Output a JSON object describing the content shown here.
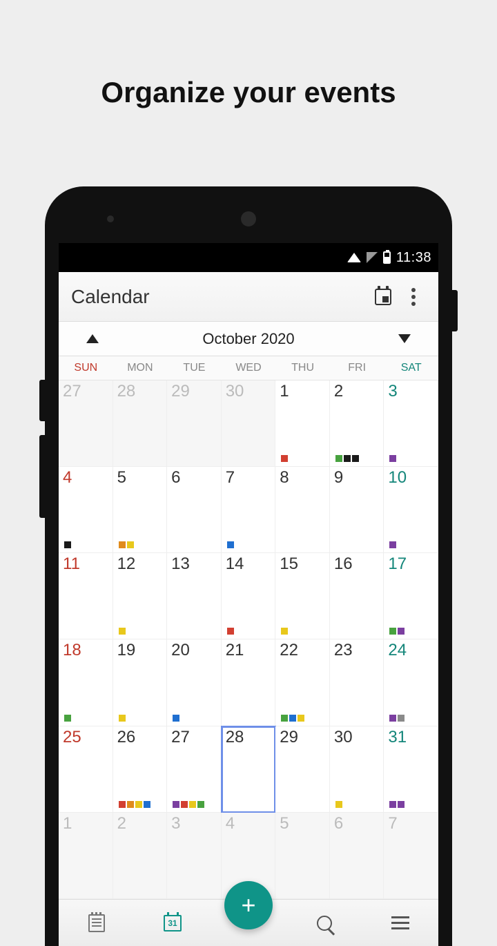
{
  "headline": "Organize your events",
  "status": {
    "time": "11:38"
  },
  "appbar": {
    "title": "Calendar"
  },
  "monthbar": {
    "label": "October 2020"
  },
  "weekdays": [
    "SUN",
    "MON",
    "TUE",
    "WED",
    "THU",
    "FRI",
    "SAT"
  ],
  "colors": {
    "red": "#d23f31",
    "green": "#48a23f",
    "black": "#1a1a1a",
    "purple": "#7b3fa0",
    "orange": "#e08b1c",
    "yellow": "#e8c81c",
    "blue": "#1f6fd0",
    "gray": "#8a8a8a",
    "teal": "#0f9488"
  },
  "grid": [
    [
      {
        "n": "27",
        "dim": true,
        "dow": "sun",
        "ev": []
      },
      {
        "n": "28",
        "dim": true,
        "ev": []
      },
      {
        "n": "29",
        "dim": true,
        "ev": []
      },
      {
        "n": "30",
        "dim": true,
        "ev": []
      },
      {
        "n": "1",
        "ev": [
          "red"
        ]
      },
      {
        "n": "2",
        "ev": [
          "green",
          "black",
          "black"
        ]
      },
      {
        "n": "3",
        "dow": "sat",
        "ev": [
          "purple"
        ]
      }
    ],
    [
      {
        "n": "4",
        "dow": "sun",
        "ev": [
          "black"
        ]
      },
      {
        "n": "5",
        "ev": [
          "orange",
          "yellow"
        ]
      },
      {
        "n": "6",
        "ev": []
      },
      {
        "n": "7",
        "ev": [
          "blue"
        ]
      },
      {
        "n": "8",
        "ev": []
      },
      {
        "n": "9",
        "ev": []
      },
      {
        "n": "10",
        "dow": "sat",
        "ev": [
          "purple"
        ]
      }
    ],
    [
      {
        "n": "11",
        "dow": "sun",
        "ev": []
      },
      {
        "n": "12",
        "ev": [
          "yellow"
        ]
      },
      {
        "n": "13",
        "ev": []
      },
      {
        "n": "14",
        "ev": [
          "red"
        ]
      },
      {
        "n": "15",
        "ev": [
          "yellow"
        ]
      },
      {
        "n": "16",
        "ev": []
      },
      {
        "n": "17",
        "dow": "sat",
        "ev": [
          "green",
          "purple"
        ]
      }
    ],
    [
      {
        "n": "18",
        "dow": "sun",
        "ev": [
          "green"
        ]
      },
      {
        "n": "19",
        "ev": [
          "yellow"
        ]
      },
      {
        "n": "20",
        "ev": [
          "blue"
        ]
      },
      {
        "n": "21",
        "ev": []
      },
      {
        "n": "22",
        "ev": [
          "green",
          "blue",
          "yellow"
        ]
      },
      {
        "n": "23",
        "ev": []
      },
      {
        "n": "24",
        "dow": "sat",
        "ev": [
          "purple",
          "gray"
        ]
      }
    ],
    [
      {
        "n": "25",
        "dow": "sun",
        "ev": []
      },
      {
        "n": "26",
        "ev": [
          "red",
          "orange",
          "yellow",
          "blue"
        ]
      },
      {
        "n": "27",
        "ev": [
          "purple",
          "red",
          "yellow",
          "green"
        ]
      },
      {
        "n": "28",
        "today": true,
        "ev": []
      },
      {
        "n": "29",
        "ev": []
      },
      {
        "n": "30",
        "ev": [
          "yellow"
        ]
      },
      {
        "n": "31",
        "dow": "sat",
        "ev": [
          "purple",
          "purple"
        ]
      }
    ],
    [
      {
        "n": "1",
        "dim": true,
        "dow": "sun",
        "ev": []
      },
      {
        "n": "2",
        "dim": true,
        "ev": []
      },
      {
        "n": "3",
        "dim": true,
        "ev": []
      },
      {
        "n": "4",
        "dim": true,
        "ev": []
      },
      {
        "n": "5",
        "dim": true,
        "ev": []
      },
      {
        "n": "6",
        "dim": true,
        "ev": []
      },
      {
        "n": "7",
        "dim": true,
        "dow": "sat",
        "ev": []
      }
    ]
  ],
  "fab": {
    "label": "+"
  }
}
